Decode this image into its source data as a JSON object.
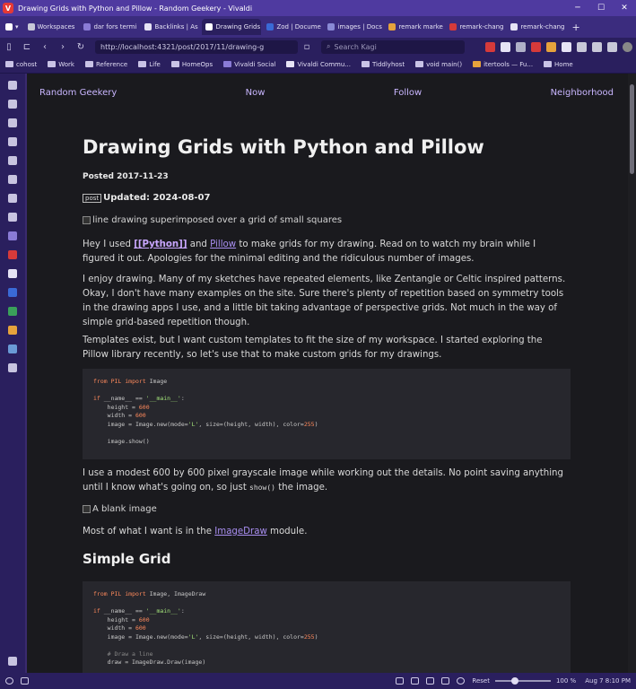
{
  "window": {
    "title": "Drawing Grids with Python and Pillow - Random Geekery - Vivaldi",
    "minimize": "─",
    "maximize": "☐",
    "close": "✕"
  },
  "tabs": [
    {
      "label": "Workspaces",
      "color": "#c8c8d8"
    },
    {
      "label": "dar fors termi",
      "color": "#8a7bd6"
    },
    {
      "label": "Backlinks | As",
      "color": "#e6e3f5"
    },
    {
      "label": "Drawing Grids",
      "color": "#ffffff",
      "active": true
    },
    {
      "label": "Zod | Docume",
      "color": "#3a6ad6"
    },
    {
      "label": "images | Docs",
      "color": "#8a8ad6"
    },
    {
      "label": "remark marke",
      "color": "#e6a23c"
    },
    {
      "label": "remark-chang",
      "color": "#d63a3a"
    },
    {
      "label": "remark-chang",
      "color": "#e6e3f5"
    }
  ],
  "address": {
    "url": "http://localhost:4321/post/2017/11/drawing-g",
    "search_placeholder": "Search Kagi"
  },
  "bookmarks": [
    "cohost",
    "Work",
    "Reference",
    "Life",
    "HomeOps",
    "Vivaldi Social",
    "Vivaldi Commu...",
    "Tiddlyhost",
    "void main()",
    "itertools — Fu...",
    "Home"
  ],
  "site_nav": [
    "Random Geekery",
    "Now",
    "Follow",
    "Neighborhood"
  ],
  "post": {
    "title": "Drawing Grids with Python and Pillow",
    "posted": "Posted 2017-11-23",
    "tag": "post",
    "updated": "Updated: 2024-08-07",
    "img1_alt": "line drawing superimposed over a grid of small squares",
    "p1_a": "Hey I used ",
    "p1_wiki": "[[Python]]",
    "p1_b": " and ",
    "p1_link": "Pillow",
    "p1_c": " to make grids for my drawing. Read on to watch my brain while I figured it out. Apologies for the minimal editing and the ridiculous number of images.",
    "p2": "I enjoy drawing. Many of my sketches have repeated elements, like Zentangle or Celtic inspired patterns. Okay, I don't have many examples on the site. Sure there's plenty of repetition based on symmetry tools in the drawing apps I use, and a little bit taking advantage of perspective grids. Not much in the way of simple grid-based repetition though.",
    "p3": "Templates exist, but I want custom templates to fit the size of my workspace. I started exploring the Pillow library recently, so let's use that to make custom grids for my drawings.",
    "p4_a": "I use a modest 600 by 600 pixel grayscale image while working out the details. No point saving anything until I know what's going on, so just ",
    "p4_code": "show()",
    "p4_b": " the image.",
    "img2_alt": "A blank image",
    "p5_a": "Most of what I want is in the ",
    "p5_link": "ImageDraw",
    "p5_b": " module.",
    "h2": "Simple Grid"
  },
  "status": {
    "reset": "Reset",
    "zoom": "100 %",
    "clock": "Aug 7 8:10 PM"
  }
}
